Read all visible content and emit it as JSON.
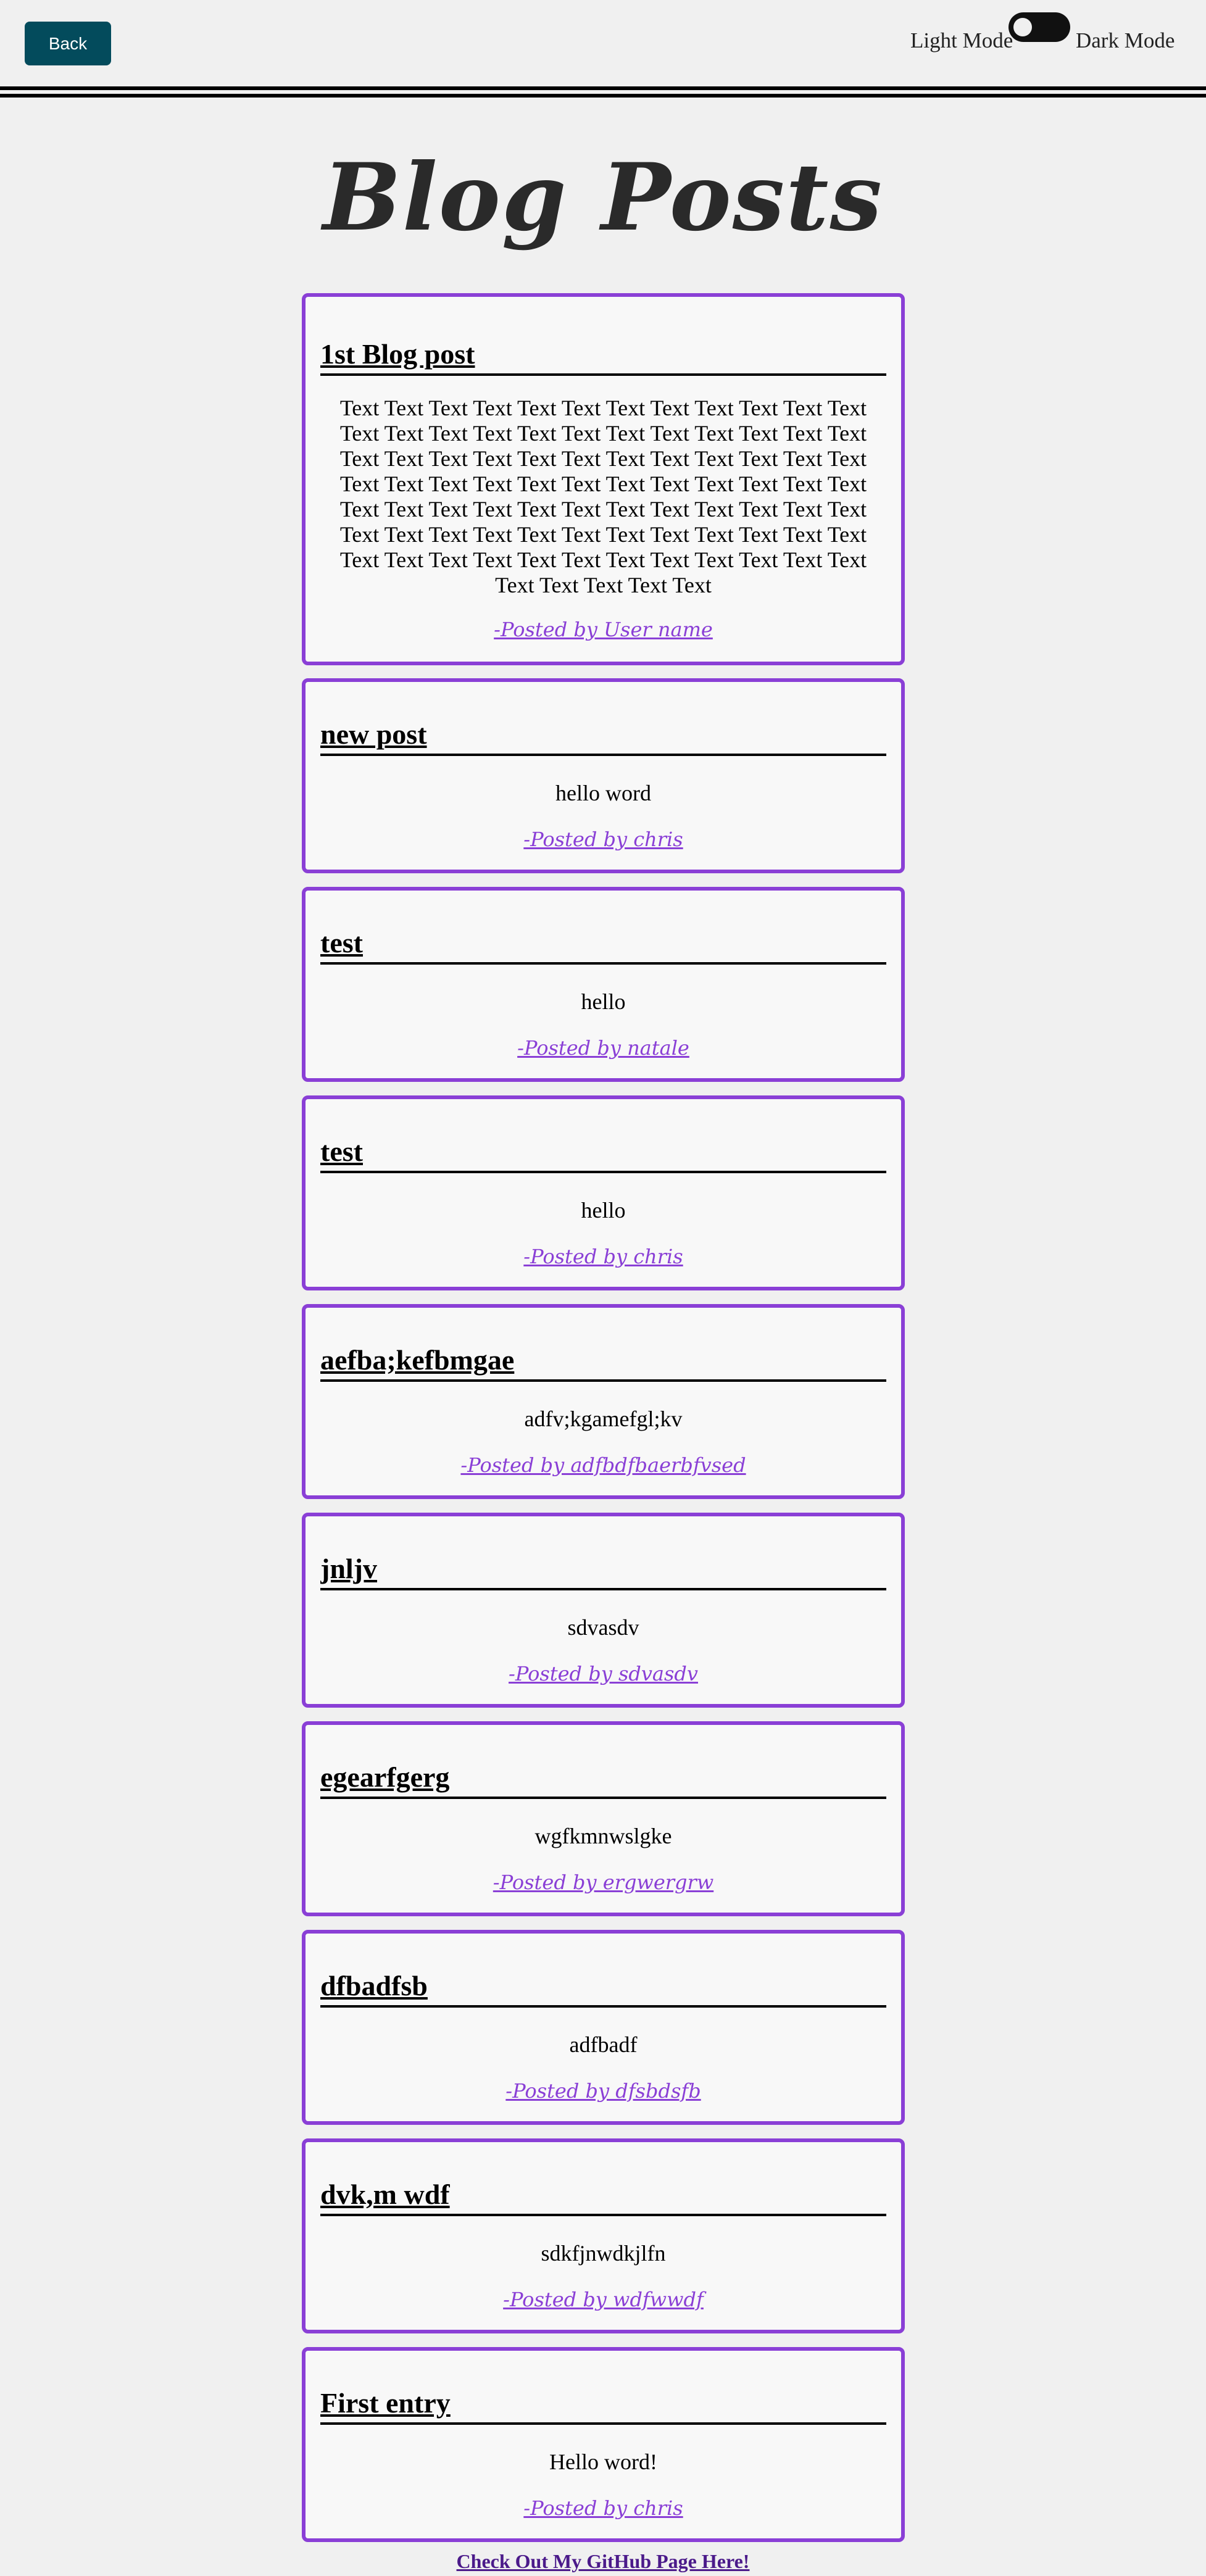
{
  "header": {
    "back_label": "Back",
    "light_mode_label": "Light Mode",
    "dark_mode_label": "Dark Mode"
  },
  "page_title": "Blog Posts",
  "posts": [
    {
      "title": "1st Blog post",
      "body": "Text Text Text Text Text Text Text Text Text Text Text Text Text Text Text Text Text Text Text Text Text Text Text Text Text Text Text Text Text Text Text Text Text Text Text Text Text Text Text Text Text Text Text Text Text Text Text Text Text Text Text Text Text Text Text Text Text Text Text Text Text Text Text Text Text Text Text Text Text Text Text Text Text Text Text Text Text Text Text Text Text Text Text Text Text Text Text Text Text",
      "author": "-Posted by User name"
    },
    {
      "title": "new post",
      "body": "hello word",
      "author": "-Posted by chris"
    },
    {
      "title": "test",
      "body": "hello",
      "author": "-Posted by natale"
    },
    {
      "title": "test",
      "body": "hello",
      "author": "-Posted by chris"
    },
    {
      "title": "aefba;kefbmgae",
      "body": "adfv;kgamefgl;kv",
      "author": "-Posted by adfbdfbaerbfvsed"
    },
    {
      "title": "jnljv",
      "body": "sdvasdv",
      "author": "-Posted by sdvasdv"
    },
    {
      "title": "egearfgerg",
      "body": "wgfkmnwslgke",
      "author": "-Posted by ergwergrw"
    },
    {
      "title": "dfbadfsb",
      "body": "adfbadf",
      "author": "-Posted by dfsbdsfb"
    },
    {
      "title": "dvk,m wdf",
      "body": "sdkfjnwdkjlfn",
      "author": "-Posted by wdfwwdf"
    },
    {
      "title": "First entry",
      "body": "Hello word!",
      "author": "-Posted by chris"
    }
  ],
  "footer": {
    "github_link": "Check Out My GitHub Page Here!"
  },
  "colors": {
    "background": "#f0f0f0",
    "card_border": "#8a3fd6",
    "back_button": "#034b5c",
    "toggle": "#111111"
  }
}
